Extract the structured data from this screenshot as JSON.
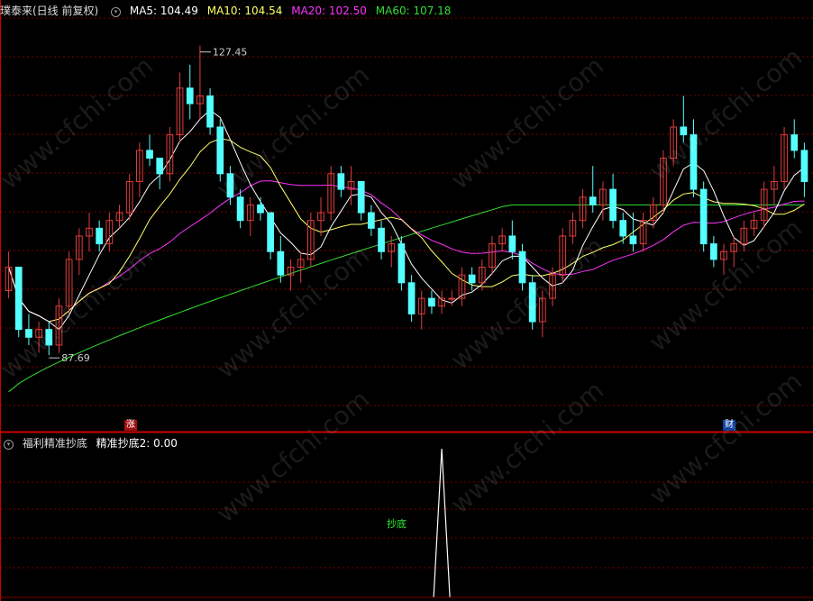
{
  "header": {
    "stock_name": "璞泰来(日线 前复权)",
    "ma5": "MA5: 104.49",
    "ma10": "MA10: 104.54",
    "ma20": "MA20: 102.50",
    "ma60": "MA60: 107.18"
  },
  "indicator": {
    "name": "福利精准抄底",
    "value": "精准抄底2: 0.00",
    "signal_label": "抄底"
  },
  "markers": {
    "zhang": "涨",
    "cai": "财"
  },
  "watermark": "www.cfchi.com",
  "colors": {
    "up": "#e03c3c",
    "down": "#54ffff",
    "ma5": "#ffffff",
    "ma10": "#ffff66",
    "ma20": "#ff33ff",
    "ma60": "#33dd33",
    "grid": "#7a0000",
    "signal_label": "#33ee33"
  },
  "chart_data": [
    {
      "type": "candlestick",
      "title": "璞泰来(日线 前复权)",
      "annotations": [
        {
          "text": "127.45",
          "kind": "high"
        },
        {
          "text": "87.69",
          "kind": "low"
        }
      ],
      "ylim": [
        78,
        131
      ],
      "candles": [
        [
          96,
          101,
          95,
          99
        ],
        [
          99,
          99,
          90,
          91
        ],
        [
          91,
          93,
          89,
          90
        ],
        [
          90,
          92,
          88,
          91
        ],
        [
          91,
          92,
          87.7,
          89
        ],
        [
          89,
          95,
          88,
          94
        ],
        [
          94,
          101,
          93,
          100
        ],
        [
          100,
          104,
          98,
          103
        ],
        [
          103,
          106,
          101,
          104
        ],
        [
          104,
          105,
          101,
          102
        ],
        [
          102,
          106,
          101,
          105
        ],
        [
          105,
          107,
          104,
          106
        ],
        [
          106,
          111,
          105,
          110
        ],
        [
          110,
          115,
          108,
          114
        ],
        [
          114,
          116,
          112,
          113
        ],
        [
          113,
          113,
          109,
          111
        ],
        [
          111,
          117,
          110,
          116
        ],
        [
          116,
          124,
          115,
          122
        ],
        [
          122,
          125,
          118,
          120
        ],
        [
          120,
          127.45,
          118,
          121
        ],
        [
          121,
          122,
          116,
          117
        ],
        [
          117,
          118,
          110,
          111
        ],
        [
          111,
          112,
          107,
          108
        ],
        [
          108,
          109,
          104,
          105
        ],
        [
          105,
          108,
          103,
          107
        ],
        [
          107,
          108,
          105,
          106
        ],
        [
          106,
          106,
          100,
          101
        ],
        [
          101,
          103,
          97,
          98
        ],
        [
          98,
          100,
          96,
          99
        ],
        [
          99,
          101,
          97,
          100
        ],
        [
          100,
          106,
          99,
          105
        ],
        [
          105,
          108,
          103,
          106
        ],
        [
          106,
          112,
          105,
          111
        ],
        [
          111,
          112,
          108,
          109
        ],
        [
          109,
          112,
          107,
          110
        ],
        [
          110,
          110,
          105,
          106
        ],
        [
          106,
          107,
          103,
          104
        ],
        [
          104,
          105,
          100,
          101
        ],
        [
          101,
          103,
          99,
          102
        ],
        [
          102,
          103,
          96,
          97
        ],
        [
          97,
          98,
          92,
          93
        ],
        [
          93,
          96,
          91,
          95
        ],
        [
          95,
          96,
          93,
          94
        ],
        [
          94,
          96,
          93,
          95
        ],
        [
          95,
          96,
          94,
          95
        ],
        [
          95,
          99,
          94,
          98
        ],
        [
          98,
          99,
          96,
          97
        ],
        [
          97,
          100,
          96,
          99
        ],
        [
          99,
          103,
          98,
          102
        ],
        [
          102,
          104,
          101,
          103
        ],
        [
          103,
          105,
          100,
          101
        ],
        [
          101,
          102,
          96,
          97
        ],
        [
          97,
          98,
          91,
          92
        ],
        [
          92,
          96,
          90,
          95
        ],
        [
          95,
          99,
          94,
          98
        ],
        [
          98,
          104,
          97,
          103
        ],
        [
          103,
          106,
          102,
          105
        ],
        [
          105,
          109,
          104,
          108
        ],
        [
          108,
          112,
          106,
          107
        ],
        [
          107,
          110,
          105,
          109
        ],
        [
          109,
          111,
          104,
          105
        ],
        [
          105,
          106,
          102,
          103
        ],
        [
          103,
          106,
          101,
          102
        ],
        [
          102,
          106,
          101,
          105
        ],
        [
          105,
          108,
          104,
          107
        ],
        [
          107,
          114,
          106,
          113
        ],
        [
          113,
          118,
          112,
          117
        ],
        [
          117,
          121,
          115,
          116
        ],
        [
          116,
          118,
          108,
          109
        ],
        [
          109,
          110,
          101,
          102
        ],
        [
          102,
          103,
          99,
          100
        ],
        [
          100,
          102,
          98,
          101
        ],
        [
          101,
          103,
          99,
          102
        ],
        [
          102,
          105,
          101,
          104
        ],
        [
          104,
          106,
          103,
          105
        ],
        [
          105,
          110,
          104,
          109
        ],
        [
          109,
          112,
          107,
          110
        ],
        [
          110,
          117,
          109,
          116
        ],
        [
          116,
          118,
          113,
          114
        ],
        [
          114,
          115,
          108,
          110
        ]
      ]
    },
    {
      "type": "line",
      "title": "福利精准抄底",
      "series": [
        {
          "name": "精准抄底2",
          "values": [
            0,
            0,
            0,
            0,
            0,
            0,
            0,
            0,
            0,
            0,
            0,
            0,
            0,
            0,
            0,
            0,
            0,
            0,
            0,
            0,
            0,
            0,
            0,
            0,
            0,
            0,
            0,
            0,
            0,
            0,
            0,
            0,
            0,
            0,
            0,
            0,
            0,
            0,
            0,
            0,
            0,
            0,
            0,
            1,
            0,
            0,
            0,
            0,
            0,
            0,
            0,
            0,
            0,
            0,
            0,
            0,
            0,
            0,
            0,
            0,
            0,
            0,
            0,
            0,
            0,
            0,
            0,
            0,
            0,
            0,
            0,
            0,
            0,
            0,
            0,
            0,
            0,
            0,
            0,
            0
          ]
        }
      ],
      "ylim": [
        0,
        1
      ]
    }
  ]
}
